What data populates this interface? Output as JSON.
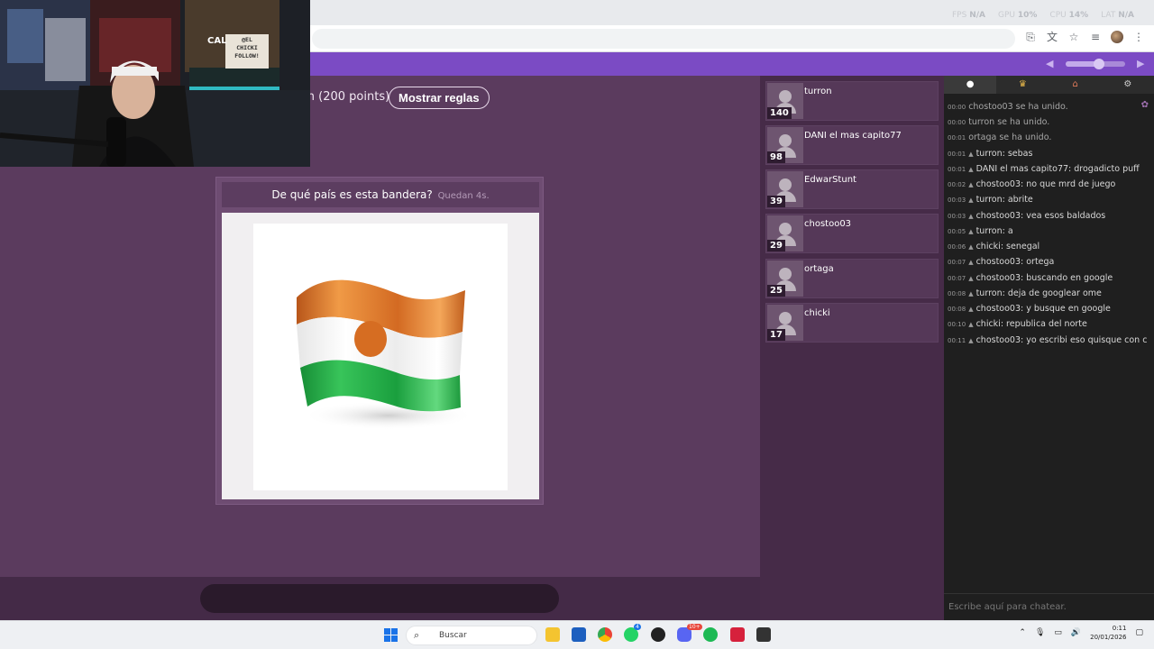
{
  "perf": {
    "fps_label": "FPS",
    "fps": "N/A",
    "gpu_label": "GPU",
    "gpu": "10%",
    "cpu_label": "CPU",
    "cpu": "14%",
    "lat_label": "LAT",
    "lat": "N/A"
  },
  "game": {
    "rule_text": "sh (200 points)",
    "rules_button": "Mostrar reglas",
    "question": "De qué país es esta bandera?",
    "time_left": "Quedan 4s.",
    "flag_colors": {
      "orange": "#e0782a",
      "white": "#ffffff",
      "green": "#1fab44"
    }
  },
  "players": [
    {
      "name": "turron",
      "score": "140"
    },
    {
      "name": "DANI el mas capito77",
      "score": "98"
    },
    {
      "name": "EdwarStunt",
      "score": "39"
    },
    {
      "name": "chostoo03",
      "score": "29"
    },
    {
      "name": "ortaga",
      "score": "25"
    },
    {
      "name": "chicki",
      "score": "17"
    }
  ],
  "chat": {
    "tabs": [
      {
        "icon": "speech-bubble-icon"
      },
      {
        "icon": "trophy-icon"
      },
      {
        "icon": "house-icon"
      },
      {
        "icon": "gear-icon"
      }
    ],
    "messages": [
      {
        "time": "00:00",
        "text": "chostoo03 se ha unido.",
        "system": true
      },
      {
        "time": "00:00",
        "text": "turron se ha unido.",
        "system": true
      },
      {
        "time": "00:01",
        "text": "ortaga se ha unido.",
        "system": true
      },
      {
        "time": "00:01",
        "text": "turron: sebas",
        "system": false
      },
      {
        "time": "00:01",
        "text": "DANI el mas capito77: drogadicto puff",
        "system": false
      },
      {
        "time": "00:02",
        "text": "chostoo03: no que mrd de juego",
        "system": false
      },
      {
        "time": "00:03",
        "text": "turron: abrite",
        "system": false
      },
      {
        "time": "00:03",
        "text": "chostoo03: vea esos baldados",
        "system": false
      },
      {
        "time": "00:05",
        "text": "turron: a",
        "system": false
      },
      {
        "time": "00:06",
        "text": "chicki: senegal",
        "system": false
      },
      {
        "time": "00:07",
        "text": "chostoo03: ortega",
        "system": false
      },
      {
        "time": "00:07",
        "text": "chostoo03: buscando en google",
        "system": false
      },
      {
        "time": "00:08",
        "text": "turron: deja de googlear ome",
        "system": false
      },
      {
        "time": "00:08",
        "text": "chostoo03: y busque en google",
        "system": false
      },
      {
        "time": "00:10",
        "text": "chicki: republica del norte",
        "system": false
      },
      {
        "time": "00:11",
        "text": "chostoo03: yo escribi eso quisque con c",
        "system": false
      }
    ],
    "input_placeholder": "Escribe aquí para chatear."
  },
  "webcam": {
    "sign_lines": [
      "@EL",
      "CHICKI",
      "FOLLOW!"
    ],
    "poster_text": "CAL"
  },
  "taskbar": {
    "search_placeholder": "Buscar",
    "time": "0:11",
    "date": "20/01/2026",
    "badges": {
      "whatsapp": "4",
      "discord": "10+"
    }
  }
}
